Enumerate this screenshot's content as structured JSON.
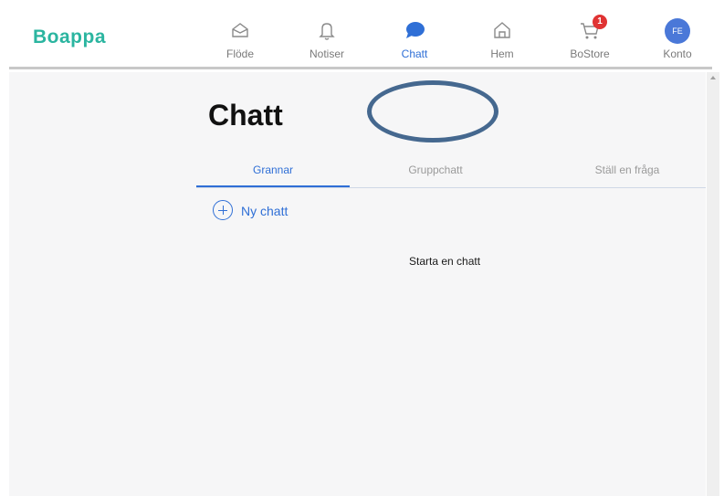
{
  "app": {
    "logo": "Boappa"
  },
  "nav": {
    "items": [
      {
        "label": "Flöde",
        "icon": "inbox-icon"
      },
      {
        "label": "Notiser",
        "icon": "bell-icon"
      },
      {
        "label": "Chatt",
        "icon": "chat-bubble-icon",
        "active": true
      },
      {
        "label": "Hem",
        "icon": "home-icon"
      },
      {
        "label": "BoStore",
        "icon": "cart-icon",
        "badge": "1"
      },
      {
        "label": "Konto",
        "icon": "avatar",
        "initials": "FE"
      }
    ]
  },
  "page": {
    "title": "Chatt"
  },
  "tabs": [
    {
      "label": "Grannar",
      "active": true
    },
    {
      "label": "Gruppchatt"
    },
    {
      "label": "Ställ en fråga"
    }
  ],
  "actions": {
    "new_chat": "Ny chatt"
  },
  "empty_state": {
    "message": "Starta en chatt"
  },
  "colors": {
    "brand": "#2bb5a0",
    "accent": "#2f6fd6",
    "badge": "#e03333",
    "annotation": "#45688f"
  }
}
